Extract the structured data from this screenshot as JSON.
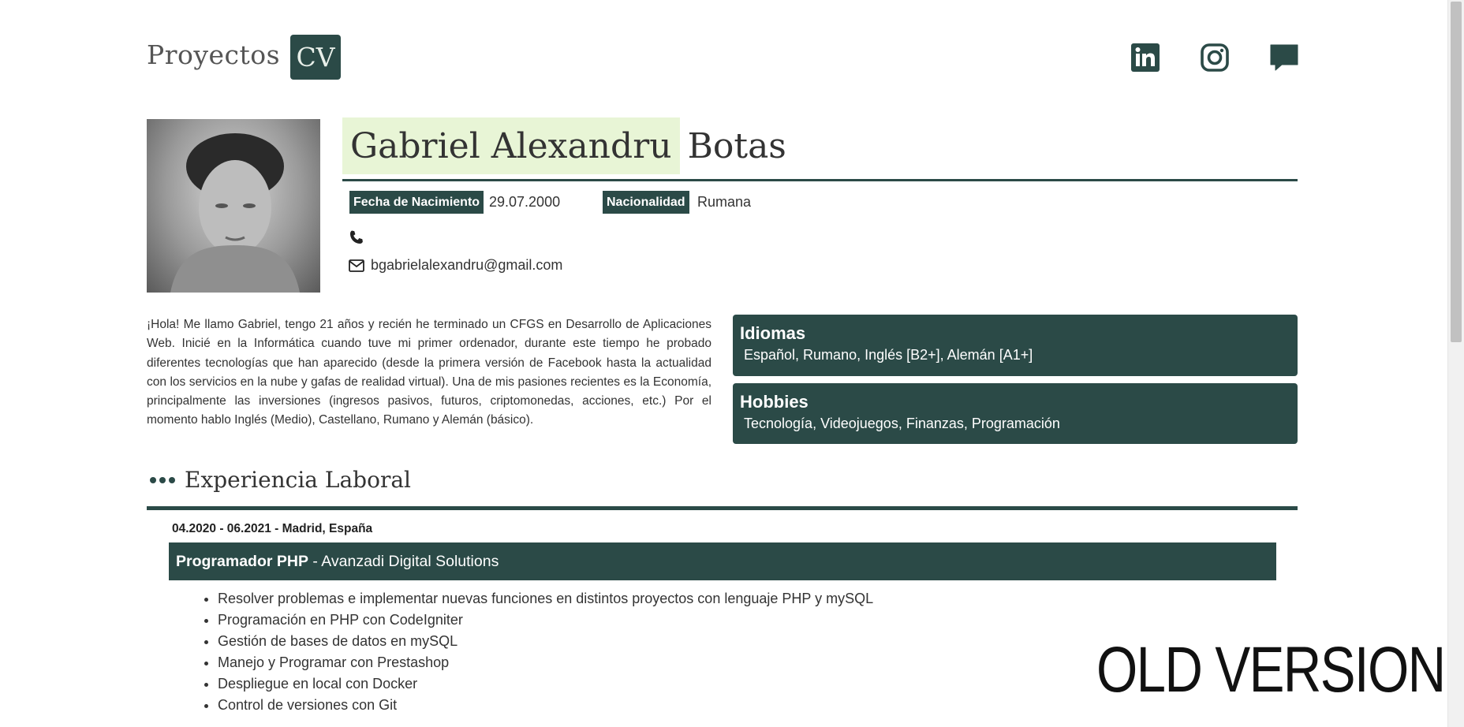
{
  "nav": {
    "projects": "Proyectos",
    "cv": "CV"
  },
  "social": {
    "icons": [
      "linkedin-icon",
      "instagram-icon",
      "chat-icon"
    ]
  },
  "profile": {
    "first_names": "Gabriel Alexandru",
    "last_name": "Botas",
    "birth_label": "Fecha de Nacimiento",
    "birth_value": "29.07.2000",
    "nationality_label": "Nacionalidad",
    "nationality_value": "Rumana",
    "phone": "",
    "email": "bgabrielalexandru@gmail.com"
  },
  "about": "¡Hola! Me llamo Gabriel, tengo 21 años y recién he terminado un CFGS en Desarrollo de Aplicaciones Web. Inicié en la Informática cuando tuve mi primer ordenador, durante este tiempo he probado diferentes tecnologías que han aparecido (desde la primera versión de Facebook hasta la actualidad con los servicios en la nube y gafas de realidad virtual). Una de mis pasiones recientes es la Economía, principalmente las inversiones (ingresos pasivos, futuros, criptomonedas, acciones, etc.) Por el momento hablo Inglés (Medio), Castellano, Rumano y Alemán (básico).",
  "cards": {
    "languages_title": "Idiomas",
    "languages_text": "Español, Rumano, Inglés [B2+], Alemán [A1+]",
    "hobbies_title": "Hobbies",
    "hobbies_text": "Tecnología, Videojuegos, Finanzas, Programación"
  },
  "experience": {
    "heading": "Experiencia Laboral",
    "job": {
      "date": "04.2020 - 06.2021 - Madrid, España",
      "role": "Programador PHP",
      "company": " - Avanzadi Digital Solutions",
      "tasks": [
        "Resolver problemas e implementar nuevas funciones en distintos proyectos con lenguaje PHP y mySQL",
        "Programación en PHP con CodeIgniter",
        "Gestión de bases de datos en mySQL",
        "Manejo y Programar con Prestashop",
        "Despliegue en local con Docker",
        "Control de versiones con Git"
      ]
    }
  },
  "watermark": "OLD VERSION",
  "colors": {
    "accent": "#2b4a47",
    "name_highlight": "#e8f5d6"
  }
}
